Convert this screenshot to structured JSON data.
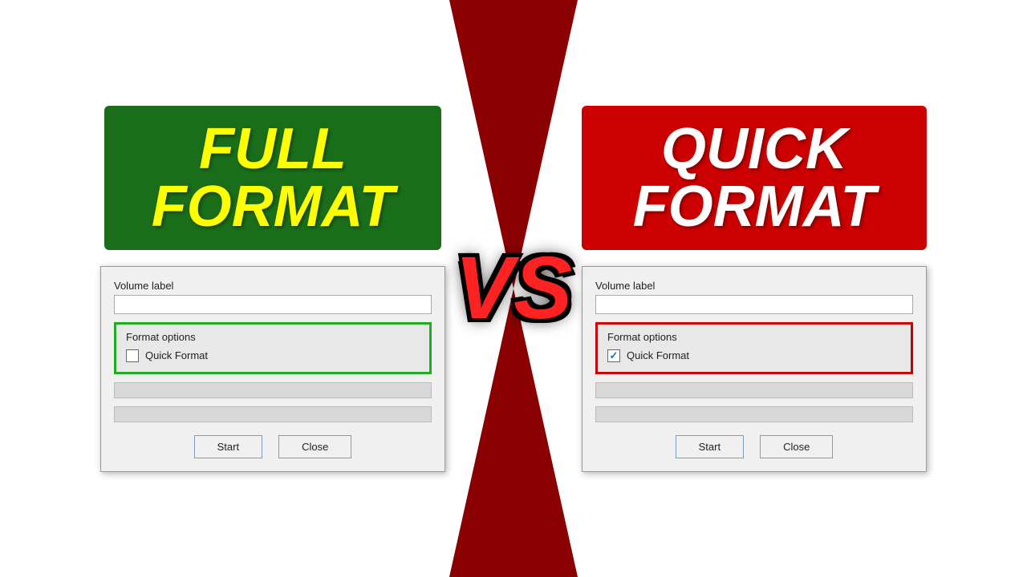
{
  "left": {
    "title_line1": "FULL",
    "title_line2": "FORMAT",
    "dialog": {
      "volume_label": "Volume label",
      "format_options_label": "Format options",
      "quick_format_label": "Quick Format",
      "quick_format_checked": false,
      "start_btn": "Start",
      "close_btn": "Close"
    }
  },
  "right": {
    "title_line1": "QUICK",
    "title_line2": "FORMAT",
    "dialog": {
      "volume_label": "Volume label",
      "format_options_label": "Format options",
      "quick_format_label": "Quick Format",
      "quick_format_checked": true,
      "start_btn": "Start",
      "close_btn": "Close"
    }
  },
  "vs_text": "VS"
}
